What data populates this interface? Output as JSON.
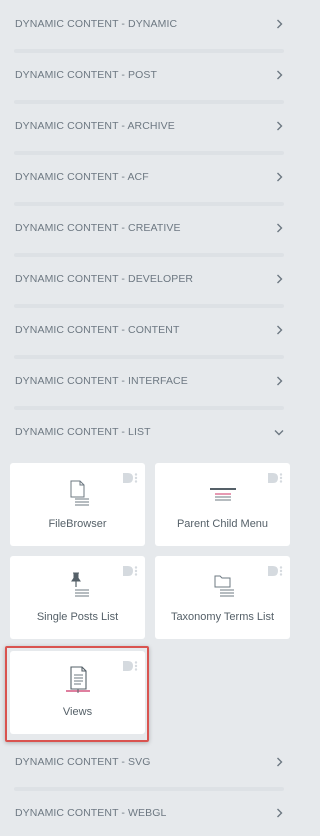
{
  "categories": [
    {
      "label": "DYNAMIC CONTENT - DYNAMIC",
      "expanded": false
    },
    {
      "label": "DYNAMIC CONTENT - POST",
      "expanded": false
    },
    {
      "label": "DYNAMIC CONTENT - ARCHIVE",
      "expanded": false
    },
    {
      "label": "DYNAMIC CONTENT - ACF",
      "expanded": false
    },
    {
      "label": "DYNAMIC CONTENT - CREATIVE",
      "expanded": false
    },
    {
      "label": "DYNAMIC CONTENT - DEVELOPER",
      "expanded": false
    },
    {
      "label": "DYNAMIC CONTENT - CONTENT",
      "expanded": false
    },
    {
      "label": "DYNAMIC CONTENT - INTERFACE",
      "expanded": false
    },
    {
      "label": "DYNAMIC CONTENT - LIST",
      "expanded": true
    },
    {
      "label": "DYNAMIC CONTENT - SVG",
      "expanded": false
    },
    {
      "label": "DYNAMIC CONTENT - WEBGL",
      "expanded": false
    }
  ],
  "widgets": [
    {
      "label": "FileBrowser",
      "icon": "file-browser-icon"
    },
    {
      "label": "Parent Child Menu",
      "icon": "parent-child-menu-icon"
    },
    {
      "label": "Single Posts List",
      "icon": "pin-list-icon"
    },
    {
      "label": "Taxonomy Terms List",
      "icon": "folder-list-icon"
    },
    {
      "label": "Views",
      "icon": "views-document-icon",
      "highlighted": true
    }
  ],
  "colors": {
    "background": "#e6e9ec",
    "tile": "#ffffff",
    "text": "#6d7882",
    "highlight": "#d9534f",
    "accent": "#c36"
  }
}
